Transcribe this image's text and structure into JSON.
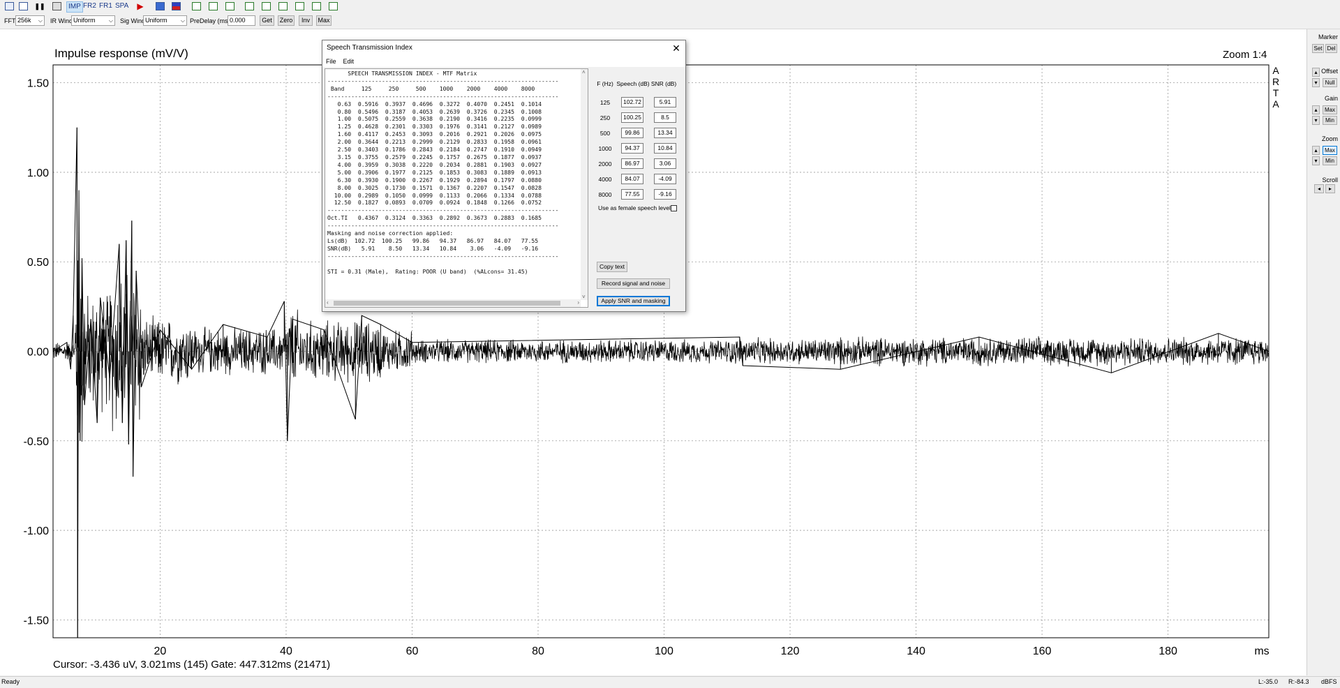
{
  "toolbar": {
    "mode_buttons": [
      "IMP",
      "FR2",
      "FR1",
      "SPA"
    ],
    "fft_label": "FFT",
    "fft_value": "256k",
    "ir_wind_label": "IR Wind",
    "ir_wind_value": "Uniform",
    "sig_wind_label": "Sig Wind",
    "sig_wind_value": "Uniform",
    "predelay_label": "PreDelay (ms)",
    "predelay_value": "0.000",
    "get_label": "Get",
    "zero_label": "Zero",
    "inv_label": "Inv",
    "max_label": "Max"
  },
  "plot": {
    "title": "Impulse response (mV/V)",
    "zoom": "Zoom 1:4",
    "brand": [
      "A",
      "R",
      "T",
      "A"
    ],
    "cursor_info": "Cursor: -3.436 uV, 3.021ms (145)  Gate: 447.312ms (21471)"
  },
  "chart_data": {
    "type": "line",
    "title": "Impulse response (mV/V)",
    "xlabel": "ms",
    "ylabel": "",
    "xlim": [
      3,
      196
    ],
    "ylim": [
      -1.6,
      1.6
    ],
    "x_ticks": [
      20,
      40,
      60,
      80,
      100,
      120,
      140,
      160,
      180
    ],
    "x_tick_labels": [
      "20",
      "40",
      "60",
      "80",
      "100",
      "120",
      "140",
      "160",
      "180"
    ],
    "x_unit_label": "ms",
    "y_ticks": [
      1.5,
      1.0,
      0.5,
      0.0,
      -0.5,
      -1.0,
      -1.5
    ],
    "y_tick_labels": [
      "1.50",
      "1.00",
      "0.50",
      "0.00",
      "-0.50",
      "-1.00",
      "-1.50"
    ],
    "grid": true,
    "series": [
      {
        "color": "#000000",
        "description_points": [
          [
            3.0,
            0.0
          ],
          [
            5.2,
            0.05
          ],
          [
            5.8,
            -0.1
          ],
          [
            6.2,
            0.2
          ],
          [
            6.8,
            1.25
          ],
          [
            6.9,
            -1.6
          ],
          [
            7.1,
            0.9
          ],
          [
            7.3,
            -0.5
          ],
          [
            7.6,
            0.52
          ],
          [
            8.0,
            -0.3
          ],
          [
            9.0,
            0.18
          ],
          [
            10.0,
            -0.4
          ],
          [
            10.5,
            0.3
          ],
          [
            12.0,
            -0.15
          ],
          [
            13.5,
            0.6
          ],
          [
            14.0,
            -0.4
          ],
          [
            14.6,
            0.62
          ],
          [
            15.0,
            -0.52
          ],
          [
            15.5,
            0.73
          ],
          [
            15.7,
            -0.7
          ],
          [
            16.2,
            0.45
          ],
          [
            17.0,
            -0.2
          ],
          [
            20.0,
            0.12
          ],
          [
            25.0,
            -0.1
          ],
          [
            30.0,
            0.15
          ],
          [
            37.0,
            0.08
          ],
          [
            39.7,
            0.28
          ],
          [
            40.2,
            -0.5
          ],
          [
            41.0,
            0.18
          ],
          [
            46.0,
            0.12
          ],
          [
            51.0,
            -0.38
          ],
          [
            52.0,
            0.2
          ],
          [
            55.0,
            0.15
          ],
          [
            60.0,
            0.05
          ],
          [
            112.0,
            0.08
          ],
          [
            112.5,
            -0.08
          ],
          [
            128.0,
            -0.1
          ],
          [
            150.0,
            0.08
          ],
          [
            171.0,
            -0.12
          ],
          [
            188.0,
            0.1
          ],
          [
            196.0,
            0.0
          ]
        ]
      }
    ]
  },
  "right_panel": {
    "marker_label": "Marker",
    "set_label": "Set",
    "del_label": "Del",
    "offset_label": "Offset",
    "null_label": "Null",
    "gain_label": "Gain",
    "gain_max": "Max",
    "gain_min": "Min",
    "zoom_label": "Zoom",
    "zoom_max": "Max",
    "zoom_min": "Min",
    "scroll_label": "Scroll"
  },
  "dialog": {
    "title": "Speech Transmission Index",
    "menu": [
      "File",
      "Edit"
    ],
    "report_lines": [
      "      SPEECH TRANSMISSION INDEX - MTF Matrix",
      "--------------------------------------------------------------------",
      " Band     125     250     500    1000    2000    4000    8000",
      "--------------------------------------------------------------------",
      "   0.63  0.5916  0.3937  0.4696  0.3272  0.4070  0.2451  0.1014",
      "   0.80  0.5496  0.3187  0.4053  0.2639  0.3726  0.2345  0.1008",
      "   1.00  0.5075  0.2559  0.3638  0.2190  0.3416  0.2235  0.0999",
      "   1.25  0.4628  0.2301  0.3303  0.1976  0.3141  0.2127  0.0989",
      "   1.60  0.4117  0.2453  0.3093  0.2016  0.2921  0.2026  0.0975",
      "   2.00  0.3644  0.2213  0.2999  0.2129  0.2833  0.1958  0.0961",
      "   2.50  0.3403  0.1786  0.2843  0.2184  0.2747  0.1910  0.0949",
      "   3.15  0.3755  0.2579  0.2245  0.1757  0.2675  0.1877  0.0937",
      "   4.00  0.3959  0.3038  0.2220  0.2034  0.2881  0.1903  0.0927",
      "   5.00  0.3906  0.1977  0.2125  0.1853  0.3083  0.1889  0.0913",
      "   6.30  0.3930  0.1900  0.2267  0.1929  0.2894  0.1797  0.0880",
      "   8.00  0.3025  0.1730  0.1571  0.1367  0.2207  0.1547  0.0828",
      "  10.00  0.2989  0.1050  0.0999  0.1133  0.2066  0.1334  0.0788",
      "  12.50  0.1827  0.0893  0.0709  0.0924  0.1848  0.1266  0.0752",
      "--------------------------------------------------------------------",
      "Oct.TI   0.4367  0.3124  0.3363  0.2892  0.3673  0.2883  0.1685",
      "--------------------------------------------------------------------",
      "Masking and noise correction applied:",
      "Ls(dB)  102.72  100.25   99.86   94.37   86.97   84.07   77.55",
      "SNR(dB)   5.91    8.50   13.34   10.84    3.06   -4.09   -9.16",
      "--------------------------------------------------------------------",
      "",
      "STI = 0.31 (Male),  Rating: POOR (U band)  (%ALcons= 31.45)"
    ],
    "col_headers": {
      "freq": "F (Hz)",
      "speech": "Speech (dB)",
      "snr": "SNR (dB)"
    },
    "rows": [
      {
        "freq": "125",
        "speech": "102.72",
        "snr": "5.91"
      },
      {
        "freq": "250",
        "speech": "100.25",
        "snr": "8.5"
      },
      {
        "freq": "500",
        "speech": "99.86",
        "snr": "13.34"
      },
      {
        "freq": "1000",
        "speech": "94.37",
        "snr": "10.84"
      },
      {
        "freq": "2000",
        "speech": "86.97",
        "snr": "3.06"
      },
      {
        "freq": "4000",
        "speech": "84.07",
        "snr": "-4.09"
      },
      {
        "freq": "8000",
        "speech": "77.55",
        "snr": "-9.16"
      }
    ],
    "female_label": "Use as female speech levels",
    "copy_text": "Copy text",
    "record_label": "Record signal and noise",
    "apply_label": "Apply SNR and masking"
  },
  "status": {
    "ready": "Ready",
    "left_level": "L:-35.0",
    "right_level": "R:-84.3",
    "unit": "dBFS"
  }
}
